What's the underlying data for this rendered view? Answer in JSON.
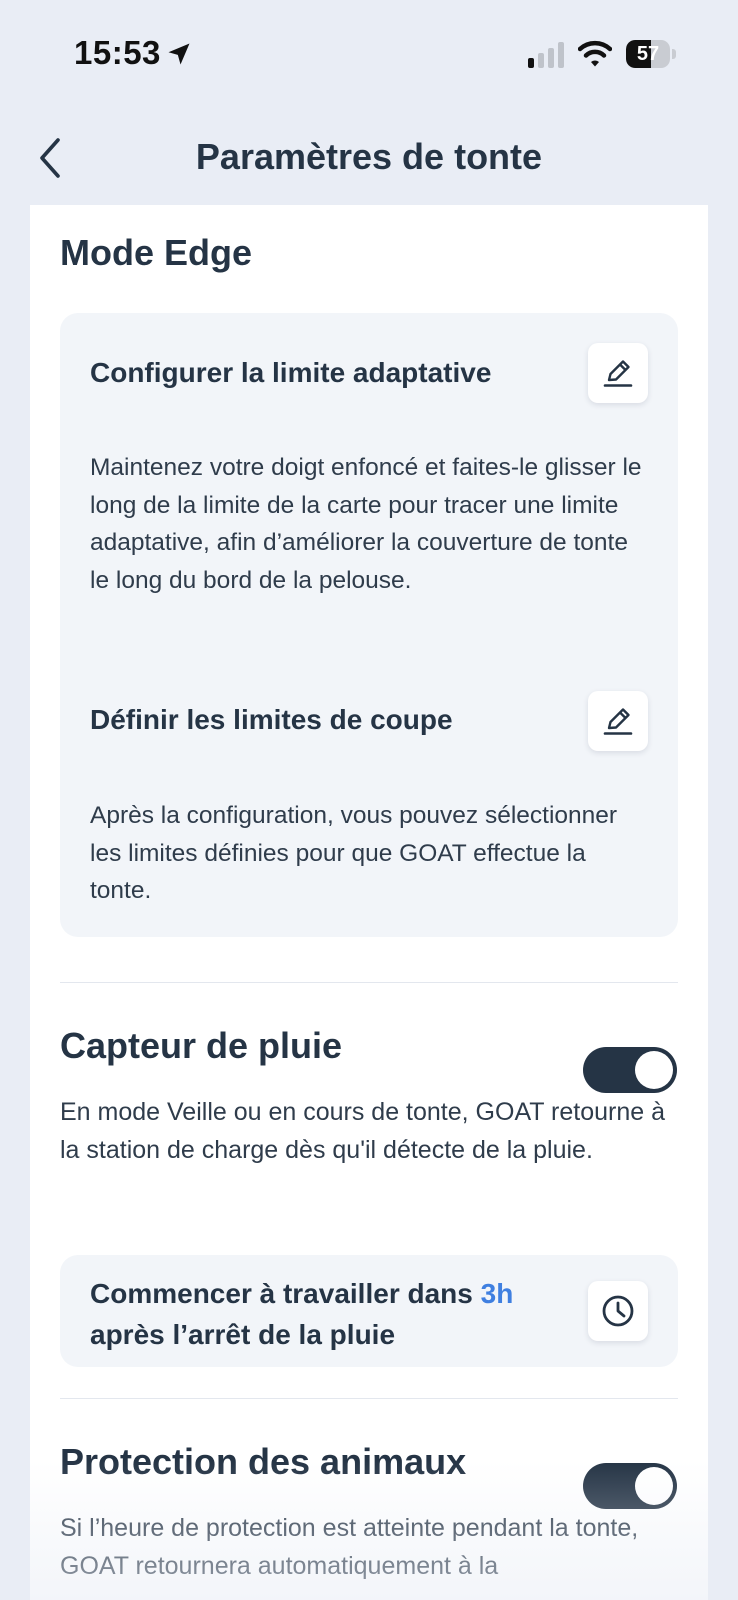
{
  "status_bar": {
    "time": "15:53",
    "battery": "57",
    "battery_level": 0.57
  },
  "header": {
    "title": "Paramètres de tonte"
  },
  "edge_mode": {
    "title": "Mode Edge",
    "adaptive": {
      "heading": "Configurer la limite adaptative",
      "text": "Maintenez votre doigt enfoncé et faites-le glisser le long de la limite de la carte pour tracer une limite adaptative, afin d’améliorer la couverture de tonte le long du bord de la pelouse."
    },
    "cut_limits": {
      "heading": "Définir les limites de coupe",
      "text": "Après la configuration, vous pouvez sélectionner les limites définies pour que GOAT effectue la tonte."
    }
  },
  "rain_sensor": {
    "title": "Capteur de pluie",
    "enabled": true,
    "text": "En mode Veille ou en cours de tonte, GOAT retourne à la station de charge dès qu'il détecte de la pluie.",
    "resume": {
      "prefix": "Commencer à travailler dans ",
      "delay": "3h",
      "suffix": "après l’arrêt de la pluie"
    }
  },
  "animal_protection": {
    "title": "Protection des animaux",
    "enabled": true,
    "text": "Si l’heure de protection est atteinte pendant la tonte, GOAT retournera automatiquement à la"
  },
  "icons": {
    "back": "chevron-left-icon",
    "edit": "pencil-edit-icon",
    "clock": "clock-icon",
    "location": "location-arrow-icon",
    "signal": "cellular-signal-icon",
    "wifi": "wifi-icon"
  },
  "colors": {
    "accent": "#3f7fe0",
    "toggle_on": "#253445",
    "text": "#253445",
    "background": "#e9edf5"
  }
}
